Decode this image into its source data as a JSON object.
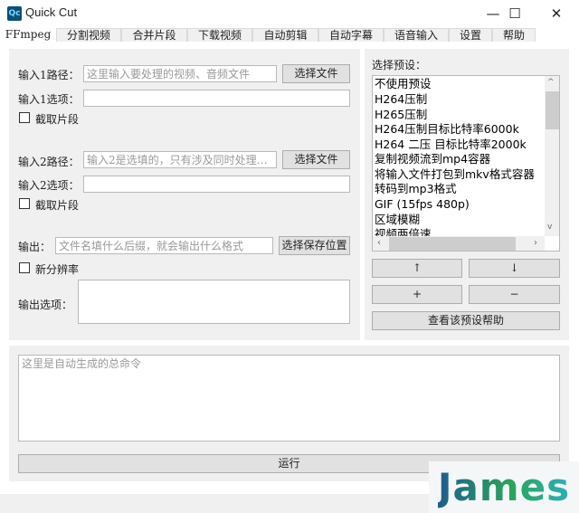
{
  "window": {
    "title": "Quick Cut",
    "logo": "Qc",
    "minimize": "—",
    "maximize": "☐",
    "close": "✕"
  },
  "tabs": [
    "FFmpeg",
    "分割视频",
    "合并片段",
    "下载视频",
    "自动剪辑",
    "自动字幕",
    "语音输入",
    "设置",
    "帮助"
  ],
  "ffmpeg": {
    "input1_label": "输入1路径：",
    "input1_placeholder": "这里输入要处理的视频、音频文件",
    "input1_button": "选择文件",
    "input1_options_label": "输入1选项：",
    "input1_options_value": "",
    "clip1_label": "截取片段",
    "input2_label": "输入2路径：",
    "input2_placeholder": "输入2是选填的，只有涉及同时处理…",
    "input2_button": "选择文件",
    "input2_options_label": "输入2选项：",
    "input2_options_value": "",
    "clip2_label": "截取片段",
    "output_label": "输出：",
    "output_placeholder": "文件名填什么后缀，就会输出什么格式",
    "output_button": "选择保存位置",
    "resolution_label": "新分辨率",
    "output_options_label": "输出选项：",
    "output_options_value": "",
    "preset_label": "选择预设：",
    "presets": [
      "不使用预设",
      "H264压制",
      "H265压制",
      "H264压制目标比特率6000k",
      "H264 二压 目标比特率2000k",
      "复制视频流到mp4容器",
      "将输入文件打包到mkv格式容器",
      "转码到mp3格式",
      "GIF (15fps 480p)",
      "区域模糊",
      "视频两倍速"
    ],
    "up_button": "↑",
    "down_button": "↓",
    "add_button": "+",
    "remove_button": "−",
    "help_button": "查看该预设帮助",
    "command_placeholder": "这里是自动生成的总命令",
    "run_button": "运行"
  },
  "watermark": "James"
}
